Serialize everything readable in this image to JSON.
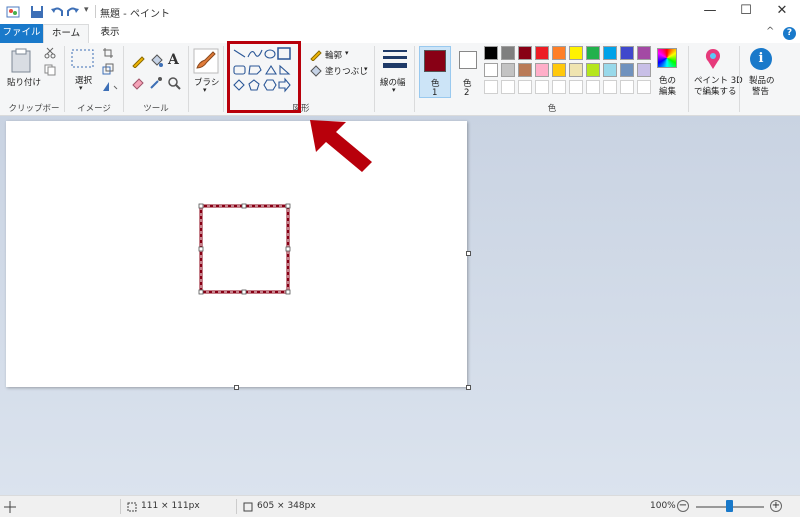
{
  "window": {
    "title": "無題 - ペイント",
    "minimize_glyph": "—",
    "maximize_glyph": "☐",
    "close_glyph": "✕",
    "qa_dropdown_glyph": "▾"
  },
  "tabs": [
    {
      "label": "ファイル"
    },
    {
      "label": "ホーム"
    },
    {
      "label": "表示"
    }
  ],
  "help_glyph": "?",
  "collapse_glyph": "^",
  "ribbon": {
    "clipboard": {
      "paste_label": "貼り付け",
      "group_label": "クリップボード"
    },
    "image": {
      "select_label": "選択",
      "group_label": "イメージ"
    },
    "tools": {
      "group_label": "ツール",
      "text_glyph": "A"
    },
    "brushes": {
      "label": "ブラシ"
    },
    "shapes": {
      "group_label": "図形"
    },
    "outline": {
      "label": "輪郭"
    },
    "fill": {
      "label": "塗りつぶし"
    },
    "size": {
      "label": "線の幅"
    },
    "color1": {
      "label": "色",
      "num": "1",
      "color": "#880015"
    },
    "color2": {
      "label": "色",
      "num": "2",
      "color": "#ffffff"
    },
    "palette_group_label": "色",
    "palette_row1": [
      "#000000",
      "#7f7f7f",
      "#880015",
      "#ed1c24",
      "#ff7f27",
      "#fff200",
      "#22b14c",
      "#00a2e8",
      "#3f48cc",
      "#a349a4"
    ],
    "palette_row2": [
      "#ffffff",
      "#c3c3c3",
      "#b97a57",
      "#ffaec9",
      "#ffc90e",
      "#efe4b0",
      "#b5e61d",
      "#99d9ea",
      "#7092be",
      "#c8bfe7"
    ],
    "edit_colors": {
      "line1": "色の",
      "line2": "編集"
    },
    "paint3d": {
      "line1": "ペイント 3D",
      "line2": "で編集する"
    },
    "product_alert": {
      "line1": "製品の",
      "line2": "警告",
      "glyph": "i"
    }
  },
  "status": {
    "selection_size": "111 × 111px",
    "canvas_size": "605 × 348px",
    "zoom": "100%",
    "zoom_out": "−",
    "zoom_in": "+"
  },
  "colors": {
    "accent": "#1979ca",
    "highlight_box": "#b8000b",
    "arrow": "#b8000b",
    "drawn_square": "#880015"
  }
}
